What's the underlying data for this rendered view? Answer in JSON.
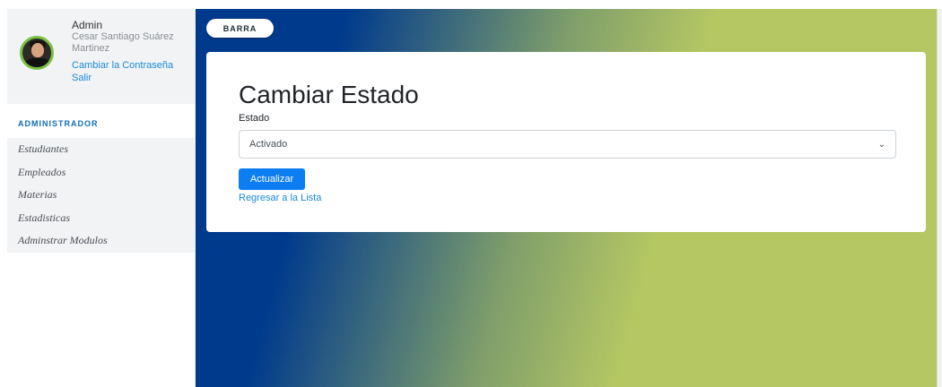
{
  "sidebar": {
    "profile": {
      "role": "Admin",
      "name": "Cesar Santiago Suárez Martinez",
      "change_password": "Cambiar la Contraseña",
      "logout": "Salir"
    },
    "section_title": "ADMINISTRADOR",
    "items": [
      {
        "label": "Estudiantes"
      },
      {
        "label": "Empleados"
      },
      {
        "label": "Materias"
      },
      {
        "label": "Estadisticas"
      },
      {
        "label": "Adminstrar Modulos"
      }
    ]
  },
  "header": {
    "barra_label": "BARRA"
  },
  "main": {
    "title": "Cambiar Estado",
    "field_label": "Estado",
    "select_value": "Activado",
    "update_button": "Actualizar",
    "back_link": "Regresar a la Lista"
  },
  "colors": {
    "accent": "#0d7ef2",
    "link": "#1a8bd6",
    "gradient_dark": "#003a8c",
    "gradient_light": "#b5c763"
  }
}
